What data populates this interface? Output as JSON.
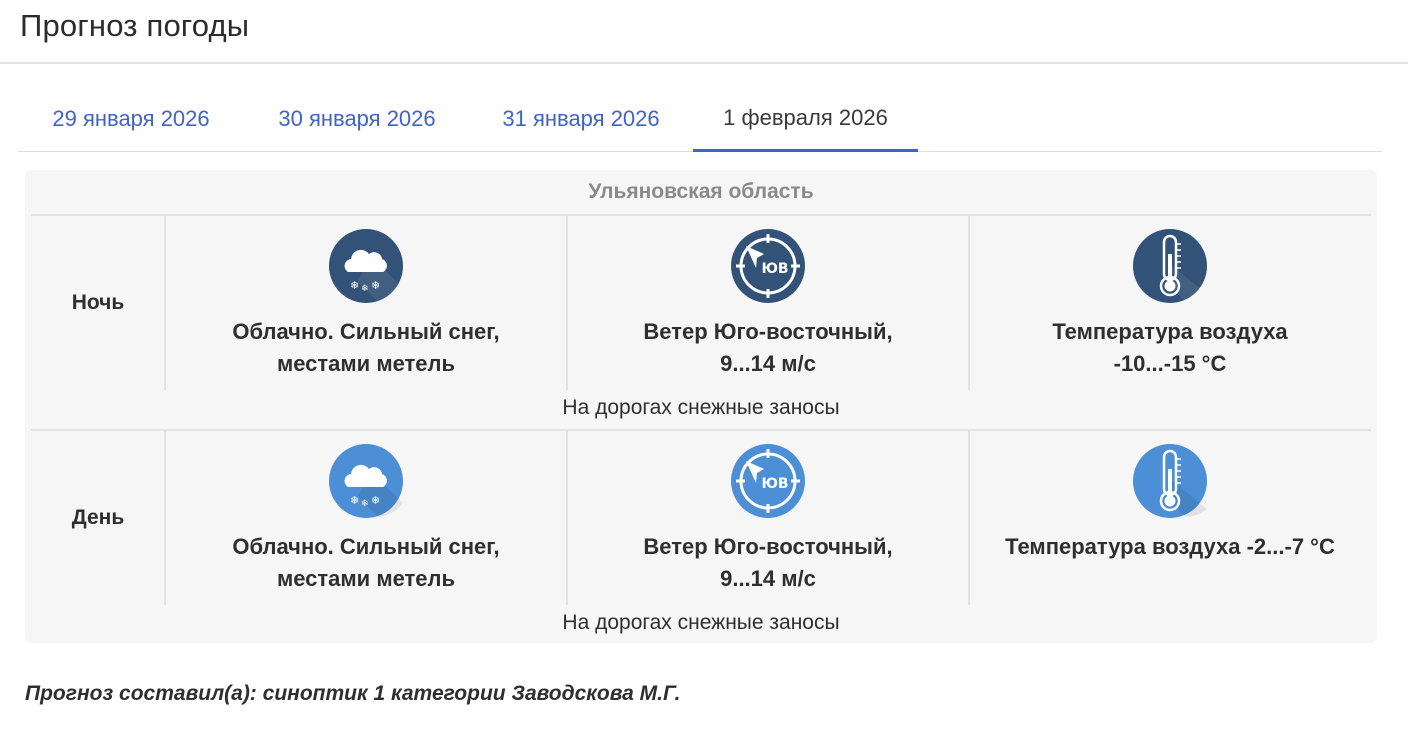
{
  "page": {
    "title": "Прогноз погоды"
  },
  "tabs": [
    {
      "label": "29 января 2026",
      "active": false
    },
    {
      "label": "30 января 2026",
      "active": false
    },
    {
      "label": "31 января 2026",
      "active": false
    },
    {
      "label": "1 февраля 2026",
      "active": true
    }
  ],
  "region": {
    "name": "Ульяновская область"
  },
  "periods": {
    "night": {
      "label": "Ночь",
      "weather": {
        "icon": "snow-cloud-icon",
        "line1": "Облачно. Сильный снег,",
        "line2": "местами метель"
      },
      "wind": {
        "icon": "wind-direction-icon",
        "badge": "ЮВ",
        "line1": "Ветер Юго-восточный,",
        "line2": "9...14 м/с"
      },
      "temp": {
        "icon": "thermometer-icon",
        "line1": "Температура воздуха",
        "line2": "-10...-15 °C"
      },
      "note": "На дорогах снежные заносы"
    },
    "day": {
      "label": "День",
      "weather": {
        "icon": "snow-cloud-icon",
        "line1": "Облачно. Сильный снег,",
        "line2": "местами метель"
      },
      "wind": {
        "icon": "wind-direction-icon",
        "badge": "ЮВ",
        "line1": "Ветер Юго-восточный,",
        "line2": "9...14 м/с"
      },
      "temp": {
        "icon": "thermometer-icon",
        "line1": "Температура воздуха -2...-7 °C"
      },
      "note": "На дорогах снежные заносы"
    }
  },
  "footer": {
    "author": "Прогноз составил(а): синоптик 1 категории Заводскова М.Г."
  },
  "colors": {
    "accent": "#3f63c9",
    "night_icon": "#325277",
    "day_icon": "#4c8fd6",
    "panel_bg": "#f6f6f6"
  }
}
